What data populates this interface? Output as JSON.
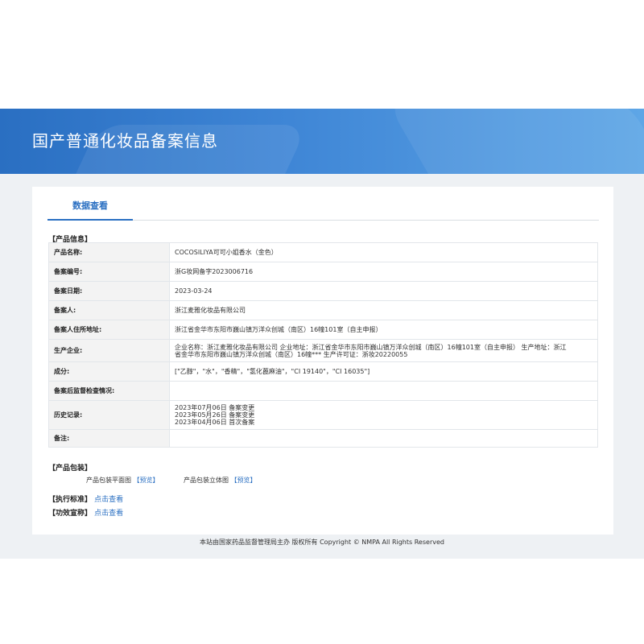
{
  "header": {
    "title": "国产普通化妆品备案信息"
  },
  "tabs": [
    {
      "label": "数据查看"
    }
  ],
  "product_info": {
    "section_label": "【产品信息】",
    "rows": [
      {
        "key": "产品名称:",
        "value": "COCOSILIYA可可小姐香水（金色）"
      },
      {
        "key": "备案编号:",
        "value": "浙G妆网备字2023006716"
      },
      {
        "key": "备案日期:",
        "value": "2023-03-24"
      },
      {
        "key": "备案人:",
        "value": "浙江麦雅化妆品有限公司"
      },
      {
        "key": "备案人住所地址:",
        "value": "浙江省金华市东阳市巍山镇万洋众创城（南区）16幢101室（自主申报）"
      },
      {
        "key": "生产企业:",
        "lines": [
          "企业名称：浙江麦雅化妆品有限公司 企业地址：浙江省金华市东阳市巍山镇万洋众创城（南区）16幢101室（自主申报） 生产地址：浙江",
          "省金华市东阳市巍山镇万洋众创城（南区）16幢*** 生产许可证：浙妆20220055"
        ]
      },
      {
        "key": "成分:",
        "value": "[\"乙醇\"，\"水\"，\"香精\"，\"氢化蓖麻油\"，\"CI 19140\"，\"CI 16035\"]"
      },
      {
        "key": "备案后监督检查情况:",
        "value": ""
      },
      {
        "key": "历史记录:",
        "lines": [
          "2023年07月06日 备案变更",
          "2023年05月26日 备案变更",
          "2023年04月06日 首次备案"
        ]
      },
      {
        "key": "备注:",
        "value": ""
      }
    ]
  },
  "packaging": {
    "section_label": "【产品包装】",
    "flat_label": "产品包装平面图",
    "flat_link": "【预览】",
    "stereo_label": "产品包装立体图",
    "stereo_link": "【预览】"
  },
  "standard": {
    "label": "【执行标准】",
    "link": "点击查看"
  },
  "efficacy": {
    "label": "【功效宣称】",
    "link": "点击查看"
  },
  "footer": {
    "text": "本站由国家药品监督管理局主办 版权所有 Copyright © NMPA All Rights Reserved"
  },
  "colors": {
    "accent": "#2a6fc2",
    "table_border": "#7fa6d6",
    "label_bg": "#f3f3f3",
    "page_bg": "#eef1f4"
  }
}
